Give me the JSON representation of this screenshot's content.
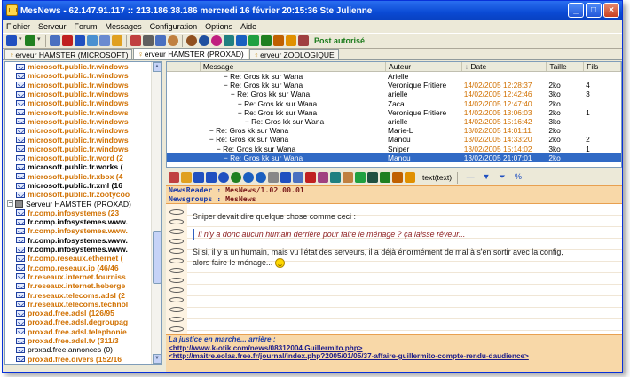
{
  "window": {
    "title": "MesNews - 62.147.91.117 :: 213.186.38.186     mercredi 16 février  20:15:36     Ste Julienne",
    "controls": [
      "_",
      "□",
      "×"
    ]
  },
  "menu": [
    "Fichier",
    "Serveur",
    "Forum",
    "Messages",
    "Configuration",
    "Options",
    "Aide"
  ],
  "toolbar": {
    "post_status": "Post autorisé",
    "icons": [
      {
        "name": "connect-icon",
        "color": "#2050c0"
      },
      {
        "name": "dropdown-icon",
        "color": "#888"
      },
      {
        "name": "refresh-icon",
        "color": "#208020"
      },
      {
        "name": "dropdown-icon",
        "color": "#888"
      },
      {
        "name": "grid-icon",
        "color": "#4a70c0"
      },
      {
        "name": "stop-icon",
        "color": "#c02020"
      },
      {
        "name": "save-icon",
        "color": "#2050c0"
      },
      {
        "name": "preview-icon",
        "color": "#4a90d0"
      },
      {
        "name": "copy-icon",
        "color": "#6a8ad0"
      },
      {
        "name": "folder-icon",
        "color": "#e0a020"
      },
      {
        "name": "book-icon",
        "color": "#c04040"
      },
      {
        "name": "print-icon",
        "color": "#606060"
      },
      {
        "name": "grid2-icon",
        "color": "#4a70c0"
      },
      {
        "name": "wheel-icon",
        "color": "#c08040"
      },
      {
        "name": "wheel2-icon",
        "color": "#905020"
      },
      {
        "name": "search-icon",
        "color": "#2050a0"
      },
      {
        "name": "filter-icon",
        "color": "#c02080"
      },
      {
        "name": "tools-icon",
        "color": "#208080"
      },
      {
        "name": "find-icon",
        "color": "#1a60c0"
      },
      {
        "name": "flag-icon",
        "color": "#20a040"
      },
      {
        "name": "help-icon",
        "color": "#208020"
      },
      {
        "name": "scissors-icon",
        "color": "#c06000"
      },
      {
        "name": "pin-icon",
        "color": "#e09000"
      },
      {
        "name": "key-icon",
        "color": "#a04040"
      }
    ]
  },
  "tabs": [
    {
      "label": "erveur HAMSTER (MICROSOFT)",
      "active": false
    },
    {
      "label": "erveur HAMSTER (PROXAD)",
      "active": true
    },
    {
      "label": "erveur ZOOLOGIQUE",
      "active": false
    }
  ],
  "tree": [
    {
      "text": "microsoft.public.fr.windows",
      "style": "orange"
    },
    {
      "text": "microsoft.public.fr.windows",
      "style": "orange"
    },
    {
      "text": "microsoft.public.fr.windows",
      "style": "orange"
    },
    {
      "text": "microsoft.public.fr.windows",
      "style": "orange"
    },
    {
      "text": "microsoft.public.fr.windows",
      "style": "orange"
    },
    {
      "text": "microsoft.public.fr.windows",
      "style": "orange"
    },
    {
      "text": "microsoft.public.fr.windows",
      "style": "orange"
    },
    {
      "text": "microsoft.public.fr.windows",
      "style": "orange"
    },
    {
      "text": "microsoft.public.fr.windows",
      "style": "orange"
    },
    {
      "text": "microsoft.public.fr.windows",
      "style": "orange"
    },
    {
      "text": "microsoft.public.fr.word  (2",
      "style": "orange"
    },
    {
      "text": "microsoft.public.fr.works  (",
      "style": "black"
    },
    {
      "text": "microsoft.public.fr.xbox  (4",
      "style": "orange"
    },
    {
      "text": "microsoft.public.fr.xml  (16",
      "style": "black"
    },
    {
      "text": "microsoft.public.fr.zootycoo",
      "style": "orange"
    },
    {
      "text": "Serveur HAMSTER (PROXAD)",
      "style": "server"
    },
    {
      "text": "fr.comp.infosystemes  (23",
      "style": "orange"
    },
    {
      "text": "fr.comp.infosystemes.www.",
      "style": "black"
    },
    {
      "text": "fr.comp.infosystemes.www.",
      "style": "orange"
    },
    {
      "text": "fr.comp.infosystemes.www.",
      "style": "black"
    },
    {
      "text": "fr.comp.infosystemes.www.",
      "style": "black"
    },
    {
      "text": "fr.comp.reseaux.ethernet  (",
      "style": "orange"
    },
    {
      "text": "fr.comp.reseaux.ip  (46/46",
      "style": "orange"
    },
    {
      "text": "fr.reseaux.internet.fourniss",
      "style": "orange"
    },
    {
      "text": "fr.reseaux.internet.heberge",
      "style": "orange"
    },
    {
      "text": "fr.reseaux.telecoms.adsl  (2",
      "style": "orange"
    },
    {
      "text": "fr.reseaux.telecoms.technol",
      "style": "orange"
    },
    {
      "text": "proxad.free.adsl  (126/95",
      "style": "orange"
    },
    {
      "text": "proxad.free.adsl.degroupag",
      "style": "orange"
    },
    {
      "text": "proxad.free.adsl.telephonie",
      "style": "orange"
    },
    {
      "text": "proxad.free.adsl.tv  (311/3",
      "style": "orange"
    },
    {
      "text": "proxad.free.annonces  (0)",
      "style": "norm"
    },
    {
      "text": "proxad.free.divers  (152/16",
      "style": "orange"
    }
  ],
  "message_list": {
    "columns": [
      "",
      "Message",
      "Auteur",
      "Date",
      "Taille",
      "Fils"
    ],
    "rows": [
      {
        "indent": 3,
        "subject": "Re: Gros kk sur Wana",
        "author": "Arielle",
        "date": "",
        "size": "",
        "replies": ""
      },
      {
        "indent": 3,
        "subject": "Re: Gros kk sur Wana",
        "author": "Veronique Fritiere",
        "date": "14/02/2005 12:28:37",
        "size": "2ko",
        "replies": "4"
      },
      {
        "indent": 4,
        "subject": "Re: Gros kk sur Wana",
        "author": "arielle",
        "date": "14/02/2005 12:42:46",
        "size": "3ko",
        "replies": "3"
      },
      {
        "indent": 5,
        "subject": "Re: Gros kk sur Wana",
        "author": "Zaca",
        "date": "14/02/2005 12:47:40",
        "size": "2ko",
        "replies": ""
      },
      {
        "indent": 5,
        "subject": "Re: Gros kk sur Wana",
        "author": "Veronique Fritiere",
        "date": "14/02/2005 13:06:03",
        "size": "2ko",
        "replies": "1"
      },
      {
        "indent": 6,
        "subject": "Re: Gros kk sur Wana",
        "author": "arielle",
        "date": "14/02/2005 15:16:42",
        "size": "3ko",
        "replies": ""
      },
      {
        "indent": 1,
        "subject": "Re: Gros kk sur Wana",
        "author": "Marie-L",
        "date": "13/02/2005 14:01:11",
        "size": "2ko",
        "replies": ""
      },
      {
        "indent": 1,
        "subject": "Re: Gros kk sur Wana",
        "author": "Manou",
        "date": "13/02/2005 14:33:20",
        "size": "2ko",
        "replies": "2"
      },
      {
        "indent": 2,
        "subject": "Re: Gros kk sur Wana",
        "author": "Sniper",
        "date": "13/02/2005 15:14:02",
        "size": "3ko",
        "replies": "1"
      },
      {
        "indent": 3,
        "subject": "Re: Gros kk sur Wana",
        "author": "Manou",
        "date": "13/02/2005 21:07:01",
        "size": "2ko",
        "replies": "",
        "selected": true
      }
    ]
  },
  "reader": {
    "view_mode": "text(text)",
    "newsreader_label": "NewsReader :",
    "newsreader_value": "MesNews/1.02.00.01",
    "newsgroups_label": "Newsgroups :",
    "newsgroups_value": "MesNews",
    "body_intro": "Sniper devait dire quelque chose comme ceci :",
    "body_quote": "Il n'y a donc aucun humain derrière pour faire le ménage ? ça laisse rêveur...",
    "body_reply_1": "Si si, il y a un humain, mais vu l'état des serveurs, il a déjà énormément de mal à s'en sortir avec la config,",
    "body_reply_2": "alors faire le ménage...",
    "signature_title": "La justice en marche... arrière :",
    "signature_link_1": "<http://www.k-otik.com/news/08312004.Guillermito.php>",
    "signature_link_2": "<http://maitre.eolas.free.fr/journal/index.php?2005/01/05/37-affaire-guillermito-compte-rendu-daudience>"
  },
  "colors": {
    "title_bar": "#0a4ad4",
    "unread_orange": "#d07000",
    "selection": "#316ac5",
    "header_strip": "#f8d8a8"
  }
}
